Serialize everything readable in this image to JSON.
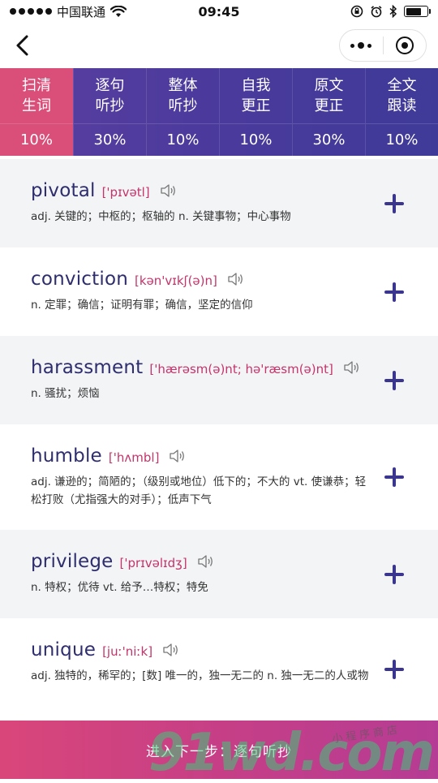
{
  "status": {
    "carrier": "中国联通",
    "time": "09:45"
  },
  "steps": [
    {
      "line1": "扫清",
      "line2": "生词",
      "percent": "10%"
    },
    {
      "line1": "逐句",
      "line2": "听抄",
      "percent": "30%"
    },
    {
      "line1": "整体",
      "line2": "听抄",
      "percent": "10%"
    },
    {
      "line1": "自我",
      "line2": "更正",
      "percent": "10%"
    },
    {
      "line1": "原文",
      "line2": "更正",
      "percent": "30%"
    },
    {
      "line1": "全文",
      "line2": "跟读",
      "percent": "10%"
    }
  ],
  "words": [
    {
      "word": "pivotal",
      "phonetic": "['pɪvətl]",
      "meaning": "adj. 关键的；中枢的；枢轴的 n. 关键事物；中心事物"
    },
    {
      "word": "conviction",
      "phonetic": "[kən'vɪkʃ(ə)n]",
      "meaning": "n. 定罪；确信；证明有罪；确信，坚定的信仰"
    },
    {
      "word": "harassment",
      "phonetic": "['hærəsm(ə)nt; hə'ræsm(ə)nt]",
      "meaning": "n. 骚扰；烦恼"
    },
    {
      "word": "humble",
      "phonetic": "['hʌmbl]",
      "meaning": "adj. 谦逊的；简陋的；（级别或地位）低下的；不大的 vt. 使谦恭；轻松打败（尤指强大的对手）；低声下气"
    },
    {
      "word": "privilege",
      "phonetic": "['prɪvəlɪdʒ]",
      "meaning": "n. 特权；优待 vt. 给予…特权；特免"
    },
    {
      "word": "unique",
      "phonetic": "[juː'niːk]",
      "meaning": "adj. 独特的，稀罕的；[数] 唯一的，独一无二的 n. 独一无二的人或物"
    }
  ],
  "next_button": "进入下一步：逐句听抄",
  "watermark": {
    "big": "91wd.com",
    "small": "小程序商店"
  },
  "colors": {
    "accent_pink": "#d94f7a",
    "tab_purple": "#4a3a9c",
    "word_navy": "#2e2d6e",
    "phonetic_red": "#c4336a"
  }
}
